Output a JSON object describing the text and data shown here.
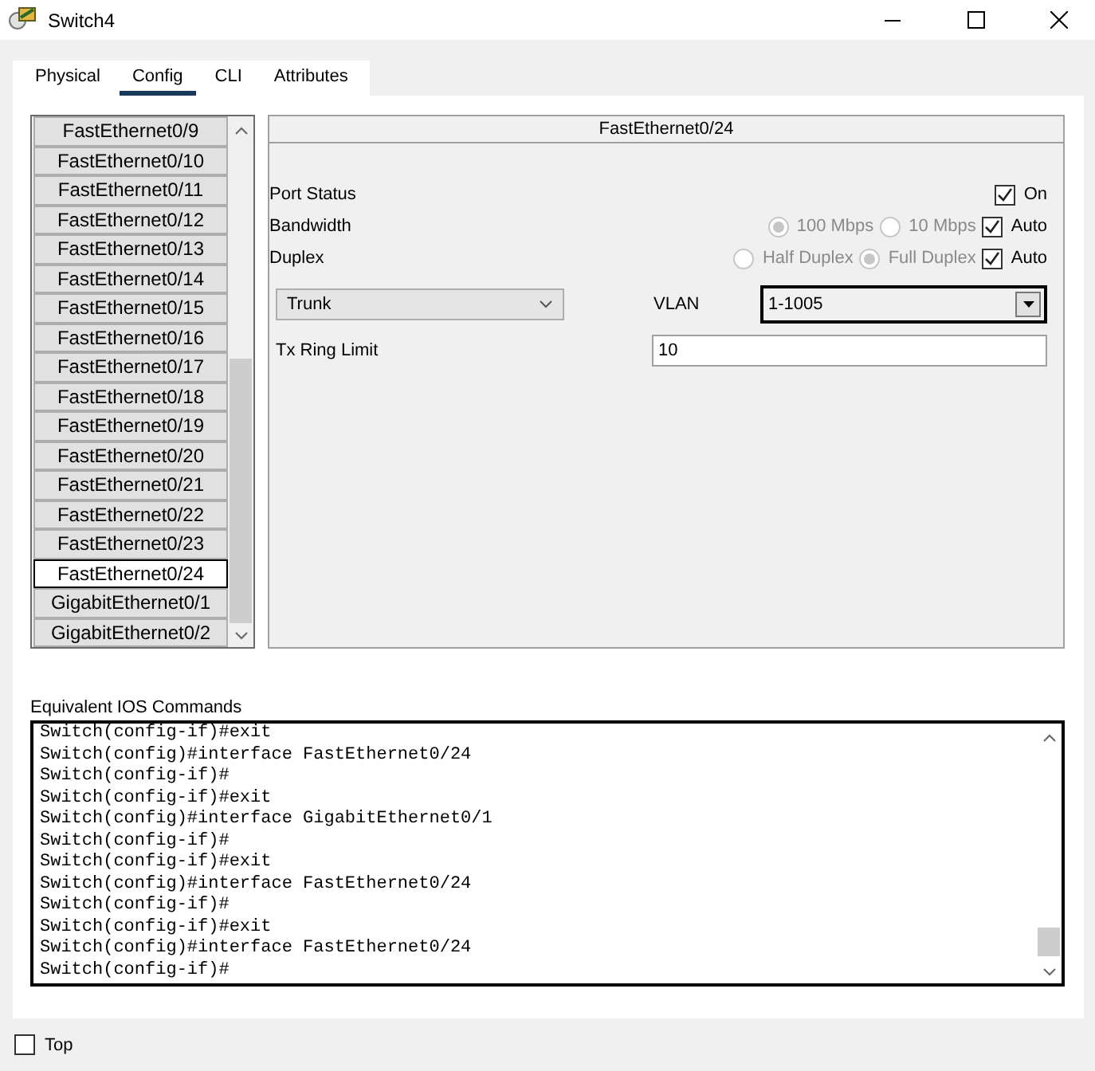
{
  "window": {
    "title": "Switch4"
  },
  "tabs": [
    {
      "label": "Physical",
      "selected": false
    },
    {
      "label": "Config",
      "selected": true
    },
    {
      "label": "CLI",
      "selected": false
    },
    {
      "label": "Attributes",
      "selected": false
    }
  ],
  "interfaces": [
    {
      "label": "FastEthernet0/9",
      "selected": false
    },
    {
      "label": "FastEthernet0/10",
      "selected": false
    },
    {
      "label": "FastEthernet0/11",
      "selected": false
    },
    {
      "label": "FastEthernet0/12",
      "selected": false
    },
    {
      "label": "FastEthernet0/13",
      "selected": false
    },
    {
      "label": "FastEthernet0/14",
      "selected": false
    },
    {
      "label": "FastEthernet0/15",
      "selected": false
    },
    {
      "label": "FastEthernet0/16",
      "selected": false
    },
    {
      "label": "FastEthernet0/17",
      "selected": false
    },
    {
      "label": "FastEthernet0/18",
      "selected": false
    },
    {
      "label": "FastEthernet0/19",
      "selected": false
    },
    {
      "label": "FastEthernet0/20",
      "selected": false
    },
    {
      "label": "FastEthernet0/21",
      "selected": false
    },
    {
      "label": "FastEthernet0/22",
      "selected": false
    },
    {
      "label": "FastEthernet0/23",
      "selected": false
    },
    {
      "label": "FastEthernet0/24",
      "selected": true
    },
    {
      "label": "GigabitEthernet0/1",
      "selected": false
    },
    {
      "label": "GigabitEthernet0/2",
      "selected": false
    }
  ],
  "port": {
    "title": "FastEthernet0/24",
    "settings": [
      {
        "label": "Port Status",
        "check": {
          "label": "On",
          "checked": true
        }
      },
      {
        "label": "Bandwidth",
        "disabled": true,
        "options": [
          {
            "label": "100 Mbps",
            "selected": true
          },
          {
            "label": "10 Mbps",
            "selected": false
          }
        ],
        "check": {
          "label": "Auto",
          "checked": true
        }
      },
      {
        "label": "Duplex",
        "disabled": true,
        "options": [
          {
            "label": "Half Duplex",
            "selected": false
          },
          {
            "label": "Full Duplex",
            "selected": true
          }
        ],
        "check": {
          "label": "Auto",
          "checked": true
        }
      }
    ],
    "mode": {
      "value": "Trunk"
    },
    "vlan": {
      "label": "VLAN",
      "value": "1-1005"
    },
    "tx_ring_limit": {
      "label": "Tx Ring Limit",
      "value": "10"
    }
  },
  "ios": {
    "label": "Equivalent IOS Commands",
    "lines": [
      "Switch(config-if)#exit",
      "Switch(config)#interface FastEthernet0/24",
      "Switch(config-if)#",
      "Switch(config-if)#exit",
      "Switch(config)#interface GigabitEthernet0/1",
      "Switch(config-if)#",
      "Switch(config-if)#exit",
      "Switch(config)#interface FastEthernet0/24",
      "Switch(config-if)#",
      "Switch(config-if)#exit",
      "Switch(config)#interface FastEthernet0/24",
      "Switch(config-if)#"
    ]
  },
  "top": {
    "label": "Top",
    "checked": false
  }
}
